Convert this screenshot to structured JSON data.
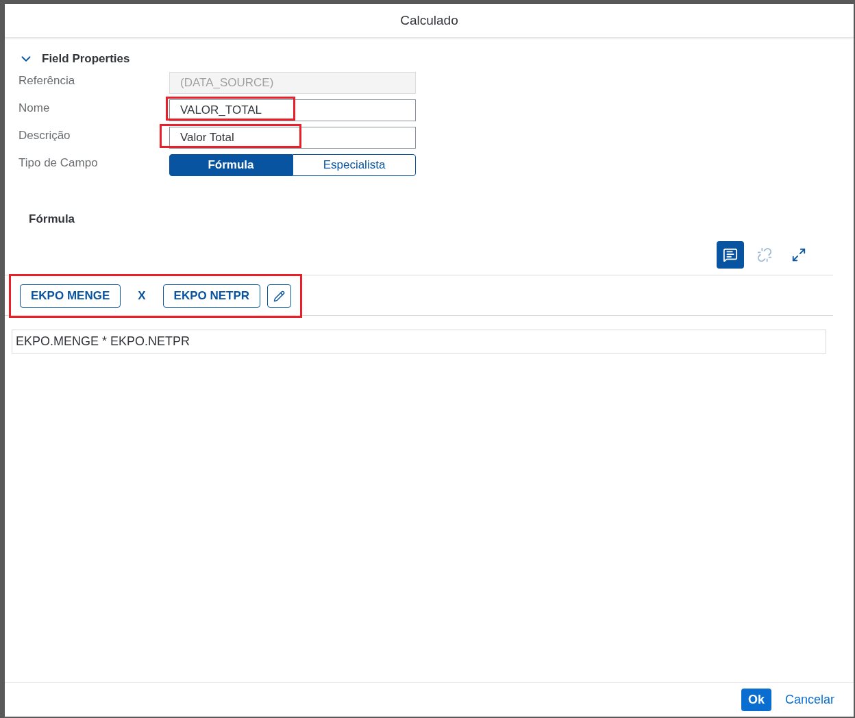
{
  "dialog": {
    "title": "Calculado"
  },
  "section": {
    "title": "Field Properties",
    "expanded": true
  },
  "fields": [
    {
      "label": "Referência",
      "value": "(DATA_SOURCE)",
      "disabled": true,
      "highlighted": false
    },
    {
      "label": "Nome",
      "value": "VALOR_TOTAL",
      "disabled": false,
      "highlighted": true
    },
    {
      "label": "Descrição",
      "value": "Valor Total",
      "disabled": false,
      "highlighted": true
    }
  ],
  "field_type": {
    "label": "Tipo de Campo",
    "options": [
      {
        "label": "Fórmula",
        "selected": true
      },
      {
        "label": "Especialista",
        "selected": false
      }
    ]
  },
  "formula": {
    "title": "Fórmula",
    "toolbar": [
      {
        "kind": "comment",
        "selected": true,
        "disabled": false
      },
      {
        "kind": "link",
        "selected": false,
        "disabled": true
      },
      {
        "kind": "expand",
        "selected": false,
        "disabled": false
      }
    ],
    "tokens": [
      {
        "kind": "field",
        "text": "EKPO MENGE"
      },
      {
        "kind": "operator",
        "text": "X"
      },
      {
        "kind": "field",
        "text": "EKPO NETPR"
      }
    ],
    "highlighted": true,
    "expression": "EKPO.MENGE * EKPO.NETPR"
  },
  "footer": {
    "buttons": [
      {
        "kind": "primary",
        "label": "Ok"
      },
      {
        "kind": "transparent",
        "label": "Cancelar"
      }
    ]
  }
}
